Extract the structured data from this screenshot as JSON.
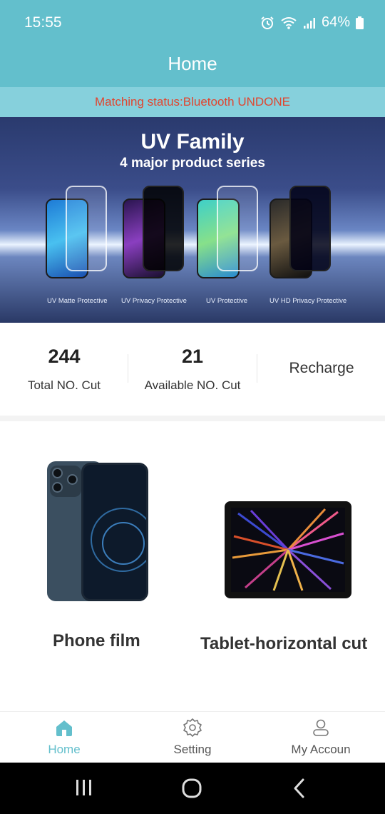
{
  "status_bar": {
    "time": "15:55",
    "battery": "64%"
  },
  "header": {
    "title": "Home"
  },
  "matching_status": "Matching status:Bluetooth UNDONE",
  "banner": {
    "title": "UV Family",
    "subtitle": "4 major product series",
    "products": [
      "UV Matte Protective",
      "UV Privacy Protective",
      "UV Protective",
      "UV HD Privacy Protective"
    ]
  },
  "stats": {
    "total": {
      "value": "244",
      "label": "Total NO. Cut"
    },
    "available": {
      "value": "21",
      "label": "Available NO. Cut"
    },
    "recharge_label": "Recharge"
  },
  "tiles": [
    {
      "label": "Phone film"
    },
    {
      "label": "Tablet-horizontal cut"
    }
  ],
  "bottom_nav": [
    {
      "label": "Home",
      "icon": "home-icon"
    },
    {
      "label": "Setting",
      "icon": "gear-icon"
    },
    {
      "label": "My Accoun",
      "icon": "user-icon"
    }
  ],
  "colors": {
    "accent": "#63bfcc",
    "status_text": "#e0452f"
  }
}
